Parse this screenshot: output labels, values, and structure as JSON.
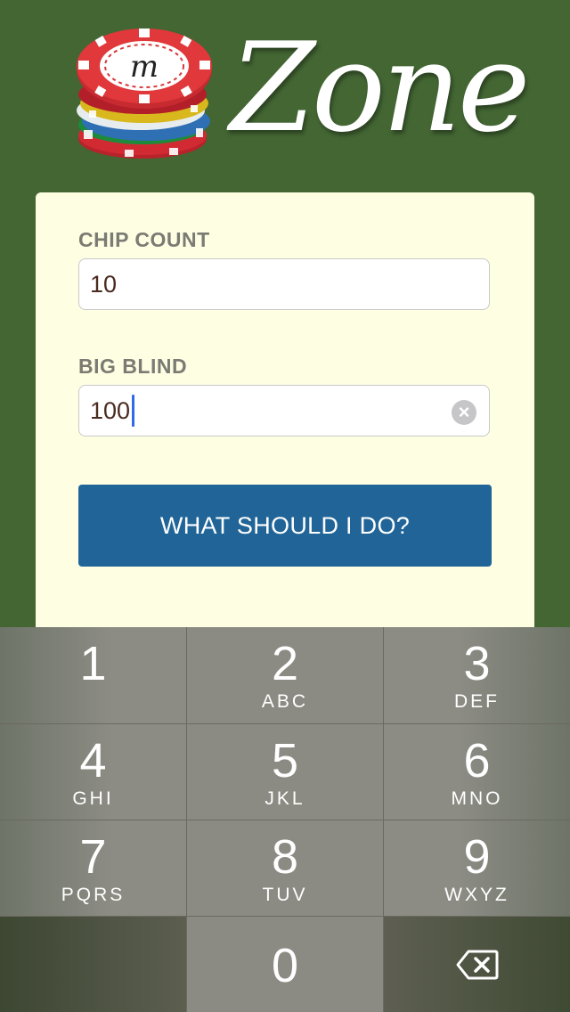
{
  "logo": {
    "chip_letter": "m",
    "word": "Zone"
  },
  "form": {
    "chip_count": {
      "label": "CHIP COUNT",
      "value": "10"
    },
    "big_blind": {
      "label": "BIG BLIND",
      "value": "100"
    },
    "submit_label": "WHAT SHOULD I DO?"
  },
  "keypad": {
    "keys": [
      {
        "digit": "1",
        "letters": ""
      },
      {
        "digit": "2",
        "letters": "ABC"
      },
      {
        "digit": "3",
        "letters": "DEF"
      },
      {
        "digit": "4",
        "letters": "GHI"
      },
      {
        "digit": "5",
        "letters": "JKL"
      },
      {
        "digit": "6",
        "letters": "MNO"
      },
      {
        "digit": "7",
        "letters": "PQRS"
      },
      {
        "digit": "8",
        "letters": "TUV"
      },
      {
        "digit": "9",
        "letters": "WXYZ"
      },
      {
        "digit": "0",
        "letters": ""
      }
    ],
    "delete_icon": "backspace-icon"
  },
  "colors": {
    "background": "#436633",
    "card": "#fefee3",
    "button": "#216598",
    "caret": "#2f6ae8"
  }
}
